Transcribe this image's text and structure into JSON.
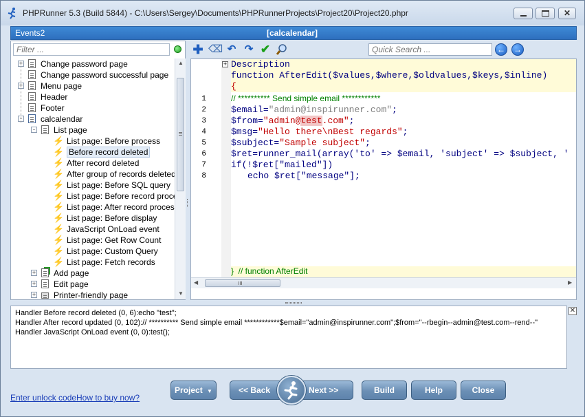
{
  "window": {
    "title": "PHPRunner 5.3 (Build 5844) - C:\\Users\\Sergey\\Documents\\PHPRunnerProjects\\Project20\\Project20.phpr"
  },
  "events_bar": {
    "label": "Events2",
    "current_table": "[calcalendar]"
  },
  "filter": {
    "placeholder": "Filter ..."
  },
  "tree": [
    {
      "label": "Change password page",
      "icon": "page-icon",
      "expander": "+"
    },
    {
      "label": "Change password successful page",
      "icon": "page-icon",
      "expander": ""
    },
    {
      "label": "Menu page",
      "icon": "page-icon",
      "expander": "+"
    },
    {
      "label": "Header",
      "icon": "page-icon",
      "expander": ""
    },
    {
      "label": "Footer",
      "icon": "page-icon",
      "expander": ""
    },
    {
      "label": "calcalendar",
      "icon": "table-icon",
      "expander": "-"
    },
    {
      "label": "List page",
      "icon": "page-icon",
      "expander": "-"
    },
    {
      "label": "List page: Before process",
      "icon": "event-icon"
    },
    {
      "label": "Before record deleted",
      "icon": "event-icon",
      "selected": true
    },
    {
      "label": "After record deleted",
      "icon": "event-icon"
    },
    {
      "label": "After group of records deleted",
      "icon": "event-icon"
    },
    {
      "label": "List page: Before SQL query",
      "icon": "event-icon"
    },
    {
      "label": "List page: Before record processed",
      "icon": "event-icon"
    },
    {
      "label": "List page: After record processed",
      "icon": "event-icon"
    },
    {
      "label": "List page: Before display",
      "icon": "event-icon"
    },
    {
      "label": "JavaScript OnLoad event",
      "icon": "event-icon"
    },
    {
      "label": "List page: Get Row Count",
      "icon": "event-icon"
    },
    {
      "label": "List page: Custom Query",
      "icon": "event-icon"
    },
    {
      "label": "List page: Fetch records",
      "icon": "event-icon"
    },
    {
      "label": "Add page",
      "icon": "add-page-icon",
      "expander": "+"
    },
    {
      "label": "Edit page",
      "icon": "edit-page-icon",
      "expander": "+"
    },
    {
      "label": "Printer-friendly page",
      "icon": "printer-icon",
      "expander": "+"
    }
  ],
  "quick_search": {
    "placeholder": "Quick Search ..."
  },
  "editor": {
    "description": "Description",
    "signature": "function AfterEdit($values,$where,$oldvalues,$keys,$inline)",
    "open_brace": "{",
    "line_numbers": [
      "1",
      "2",
      "3",
      "4",
      "5",
      "6",
      "7",
      "8"
    ],
    "line1": "// ********** Send simple email ************",
    "line2_var": "$email",
    "line2_str": "\"admin@inspirunner.com\"",
    "line2_end": ";",
    "line3_var": "$from",
    "line3_str_a": "\"admin@",
    "line3_str_hl": "test",
    "line3_str_b": ".com\"",
    "line3_end": ";",
    "line4_var": "$msg",
    "line4_str": "\"Hello there\\nBest regards\"",
    "line4_end": ";",
    "line5_var": "$subject",
    "line5_str": "\"Sample subject\"",
    "line5_end": ";",
    "line6": "$ret=runner_mail(array('to' => $email, 'subject' => $subject, '",
    "line7": "if(!$ret[\"mailed\"])",
    "line8": "echo $ret[\"message\"];",
    "footer": "}  // function AfterEdit"
  },
  "log": [
    "Handler Before record deleted (0, 6):echo \"test\";",
    "Handler After record updated (0, 102):// ********** Send simple email ************$email=\"admin@inspirunner.com\";$from=\"--rbegin--admin@test.com--rend--\"",
    "Handler JavaScript OnLoad event (0, 0):test();"
  ],
  "footer": {
    "unlock_link": "Enter unlock code",
    "buy_link": "How to buy now?",
    "project_btn": "Project",
    "back_btn": "<< Back",
    "next_btn": "Next >>",
    "build_btn": "Build",
    "help_btn": "Help",
    "close_btn": "Close"
  }
}
